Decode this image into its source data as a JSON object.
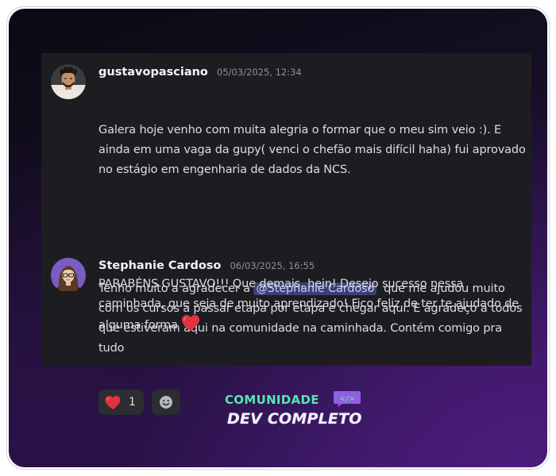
{
  "messages": [
    {
      "username": "gustavopasciano",
      "timestamp": "05/03/2025, 12:34",
      "avatar": "avatar-man-curly-hair",
      "paragraph1": "Galera hoje venho com muita alegria o formar que o meu sim veio :). E ainda em uma vaga da gupy( venci o chefão mais difícil haha) fui aprovado no estágio em engenharia de dados da NCS.",
      "paragraph2_before": "Tenho muito a agradecer a ",
      "mention": "@Stephanie Cardoso",
      "paragraph2_after": "  que me ajudou muito com os cursos a passar etapa por etapa e chegar aqui. E agradeço a todos que estiveram aqui na comunidade na caminhada. Contém comigo pra tudo"
    },
    {
      "username": "Stephanie Cardoso",
      "timestamp": "06/03/2025, 16:55",
      "avatar": "avatar-woman-glasses",
      "text": "PARABÉNS GUSTAVO!!! Que demais, hein! Desejo sucesso nessa caminhada, que seja de muito aprendizado! Fico feliz de ter te ajudado de alguma forma",
      "inline_emoji": "red-heart-icon",
      "reactions": [
        {
          "emoji": "red-heart-icon",
          "count": "1"
        }
      ],
      "add_reaction_icon": "add-reaction-icon"
    }
  ],
  "brand": {
    "line1": "COMUNIDADE",
    "badge": "</>",
    "line2": "DEV COMPLETO"
  },
  "colors": {
    "mention_bg": "#3c3f74",
    "mention_text": "#c9cdfb",
    "brand_green": "#53e6b2",
    "heart": "#e0323f",
    "chat_bg": "#1d1d21"
  }
}
